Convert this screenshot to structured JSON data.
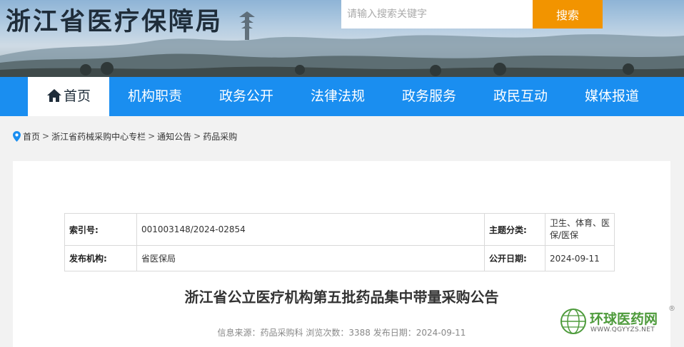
{
  "header": {
    "site_title": "浙江省医疗保障局",
    "search_placeholder": "请输入搜索关键字",
    "search_button": "搜索"
  },
  "nav": {
    "items": [
      "首页",
      "机构职责",
      "政务公开",
      "法律法规",
      "政务服务",
      "政民互动",
      "媒体报道"
    ],
    "active_index": 0
  },
  "breadcrumb": [
    "首页",
    "浙江省药械采购中心专栏",
    "通知公告",
    "药品采购"
  ],
  "meta": {
    "index_label": "索引号:",
    "index_value": "001003148/2024-02854",
    "topic_label": "主题分类:",
    "topic_value": "卫生、体育、医保/医保",
    "org_label": "发布机构:",
    "org_value": "省医保局",
    "date_label": "公开日期:",
    "date_value": "2024-09-11"
  },
  "article": {
    "title": "浙江省公立医疗机构第五批药品集中带量采购公告",
    "info": "信息来源：药品采购科 浏览次数：3388 发布日期：2024-09-11"
  },
  "watermark": {
    "name": "环球医药网",
    "url": "WWW.QGYYZS.NET",
    "mark": "®"
  },
  "colors": {
    "nav_bg": "#1a8ef0",
    "search_btn": "#f29400",
    "watermark_green": "#4e9b3c"
  }
}
